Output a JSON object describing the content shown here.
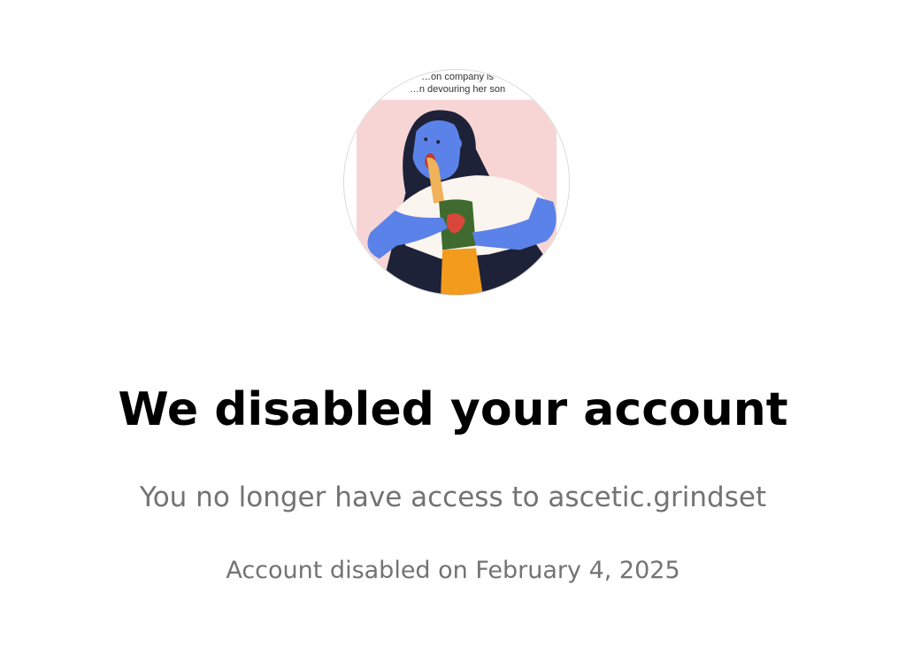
{
  "avatar": {
    "caption_line1": "…on company is",
    "caption_line2": "…n devouring her son"
  },
  "title": "We disabled your account",
  "subtitle": "You no longer have access to ascetic.grindset",
  "disabled_date_text": "Account disabled on February 4, 2025",
  "colors": {
    "title_text": "#000000",
    "secondary_text": "#737373",
    "background": "#ffffff"
  }
}
